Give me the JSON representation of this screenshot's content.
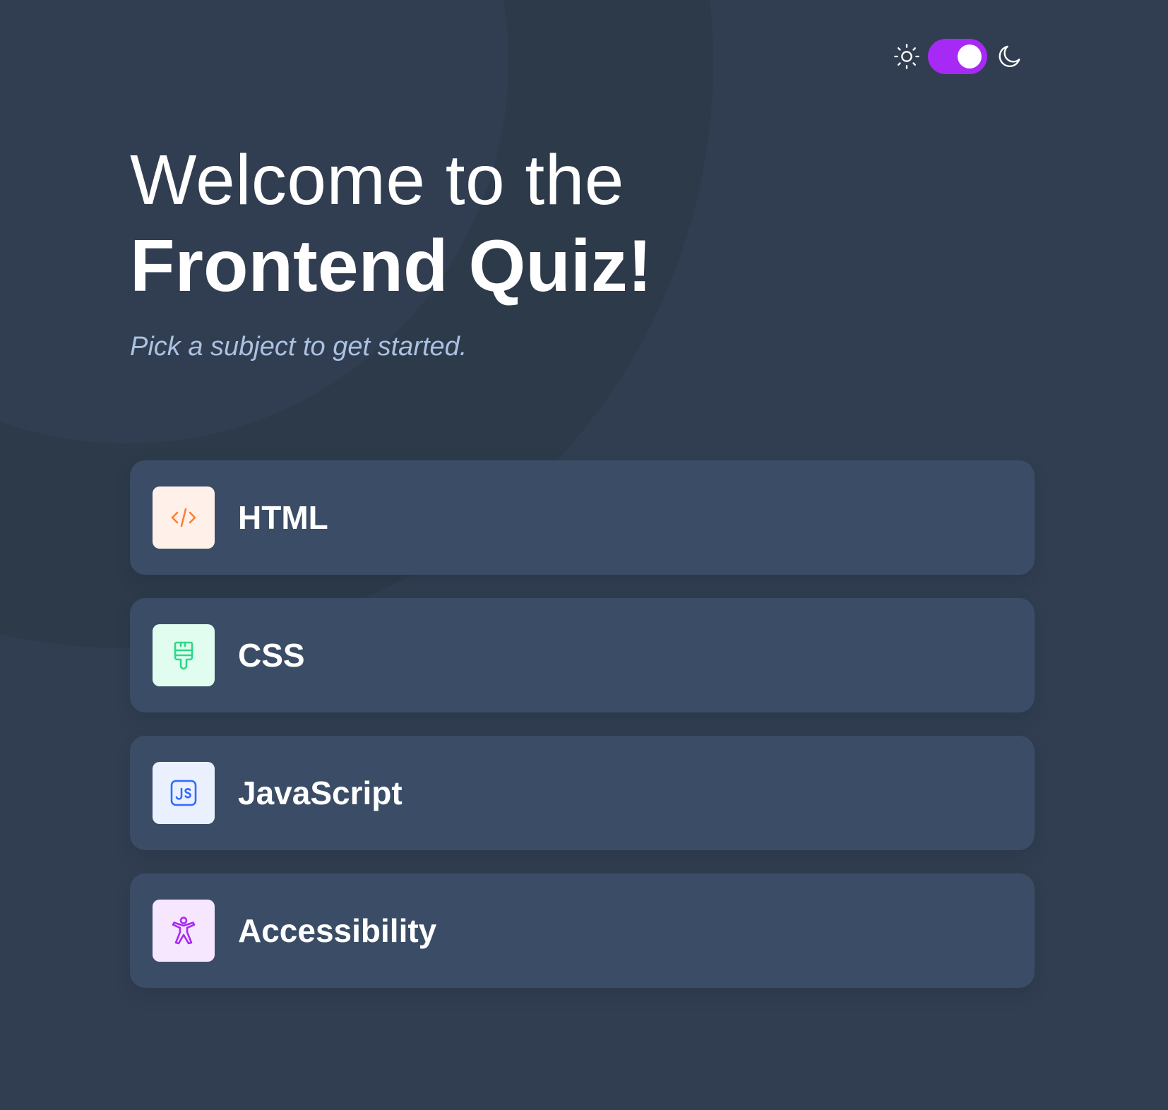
{
  "theme_toggle": {
    "light_icon": "sun-icon",
    "dark_icon": "moon-icon",
    "state": "dark",
    "accent_color": "#a729f5"
  },
  "heading": {
    "line1": "Welcome to the",
    "line2": "Frontend Quiz!"
  },
  "subtitle": "Pick a subject to get started.",
  "subjects": [
    {
      "label": "HTML",
      "icon": "html-code-icon",
      "icon_bg": "#fff1e9",
      "icon_color": "#ff7e35"
    },
    {
      "label": "CSS",
      "icon": "paintbrush-icon",
      "icon_bg": "#e0fdef",
      "icon_color": "#2fd887"
    },
    {
      "label": "JavaScript",
      "icon": "javascript-icon",
      "icon_bg": "#ebf0ff",
      "icon_color": "#306aff"
    },
    {
      "label": "Accessibility",
      "icon": "accessibility-icon",
      "icon_bg": "#f6e7ff",
      "icon_color": "#a729f5"
    }
  ],
  "colors": {
    "background": "#313e51",
    "card": "#3b4d66",
    "subtitle": "#abc1e1"
  }
}
